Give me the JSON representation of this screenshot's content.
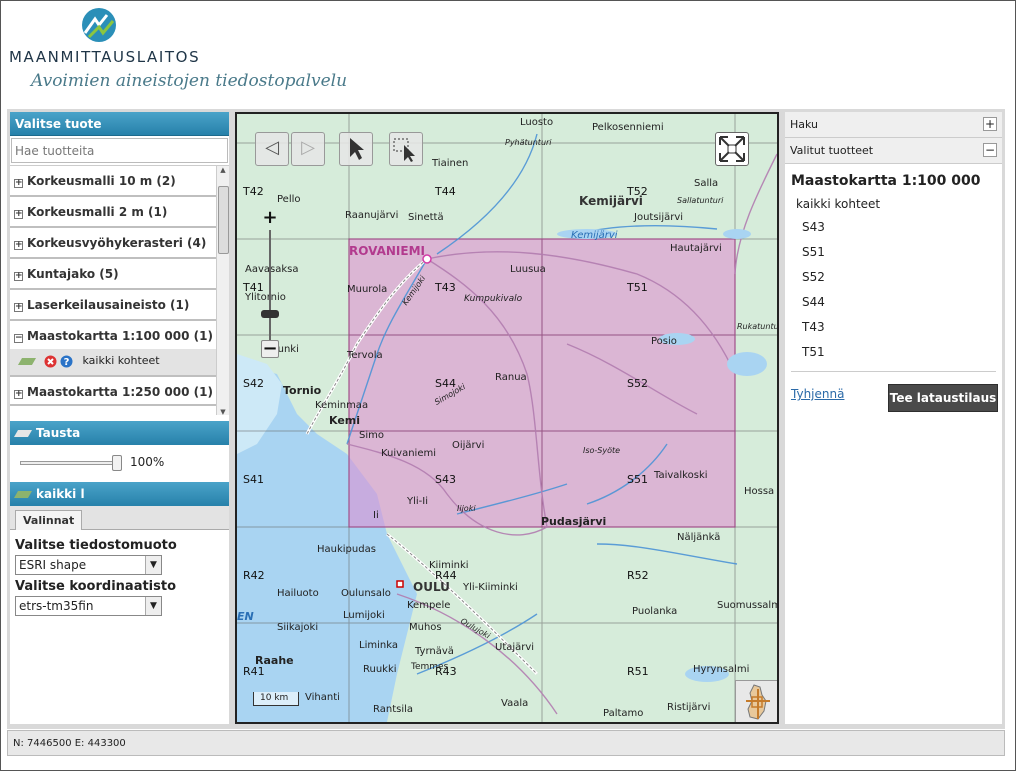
{
  "header": {
    "org": "MAANMITTAUSLAITOS",
    "service": "Avoimien aineistojen tiedostopalvelu"
  },
  "left": {
    "title": "Valitse tuote",
    "search_placeholder": "Hae tuotteita",
    "tree": [
      {
        "sign": "+",
        "label": "Korkeusmalli 10 m (2)"
      },
      {
        "sign": "+",
        "label": "Korkeusmalli 2 m (1)"
      },
      {
        "sign": "+",
        "label": "Korkeusvyöhykerasteri (4)"
      },
      {
        "sign": "+",
        "label": "Kuntajako (5)"
      },
      {
        "sign": "+",
        "label": "Laserkeilausaineisto (1)"
      },
      {
        "sign": "−",
        "label": "Maastokartta 1:100 000 (1)"
      }
    ],
    "sublayer": "kaikki kohteet",
    "tree_after": {
      "sign": "+",
      "label": "Maastokartta 1:250 000 (1)"
    },
    "background": {
      "title": "Tausta",
      "opacity": "100%",
      "opacity_value": 100
    },
    "layer_panel": {
      "title": "kaikki l",
      "tab": "Valinnat",
      "format_label": "Valitse tiedostomuoto",
      "format_value": "ESRI shape",
      "crs_label": "Valitse koordinaatisto",
      "crs_value": "etrs-tm35fin"
    }
  },
  "map": {
    "scale": "10 km",
    "grid_labels": [
      "T42",
      "T44",
      "T52",
      "T41",
      "T43",
      "T51",
      "S42",
      "S44",
      "S52",
      "S41",
      "S43",
      "S51",
      "R42",
      "R44",
      "R52",
      "R41",
      "R43",
      "R51"
    ],
    "places": [
      "Luosto",
      "Pelkosenniemi",
      "Pyhätunturi",
      "Tiainen",
      "Kemijärvi",
      "Salla",
      "Pello",
      "Raanujärvi",
      "Sinettä",
      "Joutsijärvi",
      "Sallatunturi",
      "Kemijärvi",
      "Hautajärvi",
      "ROVANIEMI",
      "Aavasaksa",
      "Muurola",
      "Kemijoki",
      "Luusua",
      "Ylitornio",
      "Kumpukivalo",
      "Rukatunturi",
      "Posio",
      "Karunki",
      "Tervola",
      "Ranua",
      "Tornio",
      "Simojoki",
      "Keminmaa",
      "Kemi",
      "Simo",
      "Oijärvi",
      "Kuivaniemi",
      "Iso-Syöte",
      "Taivalkoski",
      "Hossa",
      "Yli-Ii",
      "Iijoki",
      "Ii",
      "Pudasjärvi",
      "Haukipudas",
      "Näljänkä",
      "Kiiminki",
      "Hailuoto",
      "OULU",
      "Yli-Kiiminki",
      "Oulunsalo",
      "Kempele",
      "Puolanka",
      "Lumijoki",
      "Suomussalmi",
      "Siikajoki",
      "Muhos",
      "Oulujoki",
      "Liminka",
      "Raahe",
      "Tyrnävä",
      "Utajärvi",
      "Ruukki",
      "Temmes",
      "Hyrynsalmi",
      "Vihanti",
      "Rantsila",
      "Vaala",
      "Paltamo",
      "Ristijärvi",
      "EN",
      "Vihanti"
    ]
  },
  "right": {
    "search_title": "Haku",
    "selected_title": "Valitut tuotteet",
    "product_title": "Maastokartta 1:100 000",
    "all_features": "kaikki kohteet",
    "items": [
      "S43",
      "S51",
      "S52",
      "S44",
      "T43",
      "T51"
    ],
    "clear_label": "Tyhjennä",
    "order_label": "Tee lataustilaus"
  },
  "status": {
    "coords": "N: 7446500 E: 443300"
  },
  "colors": {
    "accent": "#2e8ab5",
    "selection": "#e08ad0",
    "water": "#a9d4f2",
    "land": "#d6ecda"
  }
}
